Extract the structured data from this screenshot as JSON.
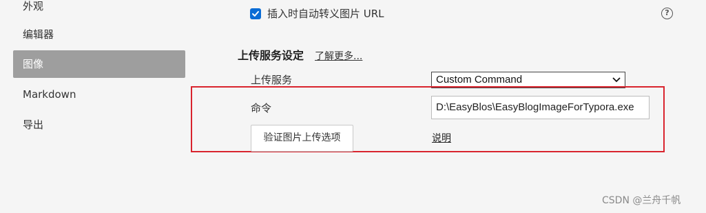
{
  "sidebar": {
    "items": [
      {
        "label": "外观"
      },
      {
        "label": "编辑器"
      },
      {
        "label": "图像"
      },
      {
        "label": "Markdown"
      },
      {
        "label": "导出"
      }
    ]
  },
  "auto_escape": {
    "label": "插入时自动转义图片 URL",
    "checked": true
  },
  "upload_section": {
    "title": "上传服务设定",
    "learn_more": "了解更多...",
    "service_label": "上传服务",
    "service_value": "Custom Command",
    "command_label": "命令",
    "command_value": "D:\\EasyBlos\\EasyBlogImageForTypora.exe",
    "verify_button": "验证图片上传选项",
    "explain_link": "说明"
  },
  "help_icon": "question-circle",
  "accent_color": "#0a6cd5",
  "highlight_color": "#d9232d",
  "watermark": "CSDN @兰舟千帆"
}
